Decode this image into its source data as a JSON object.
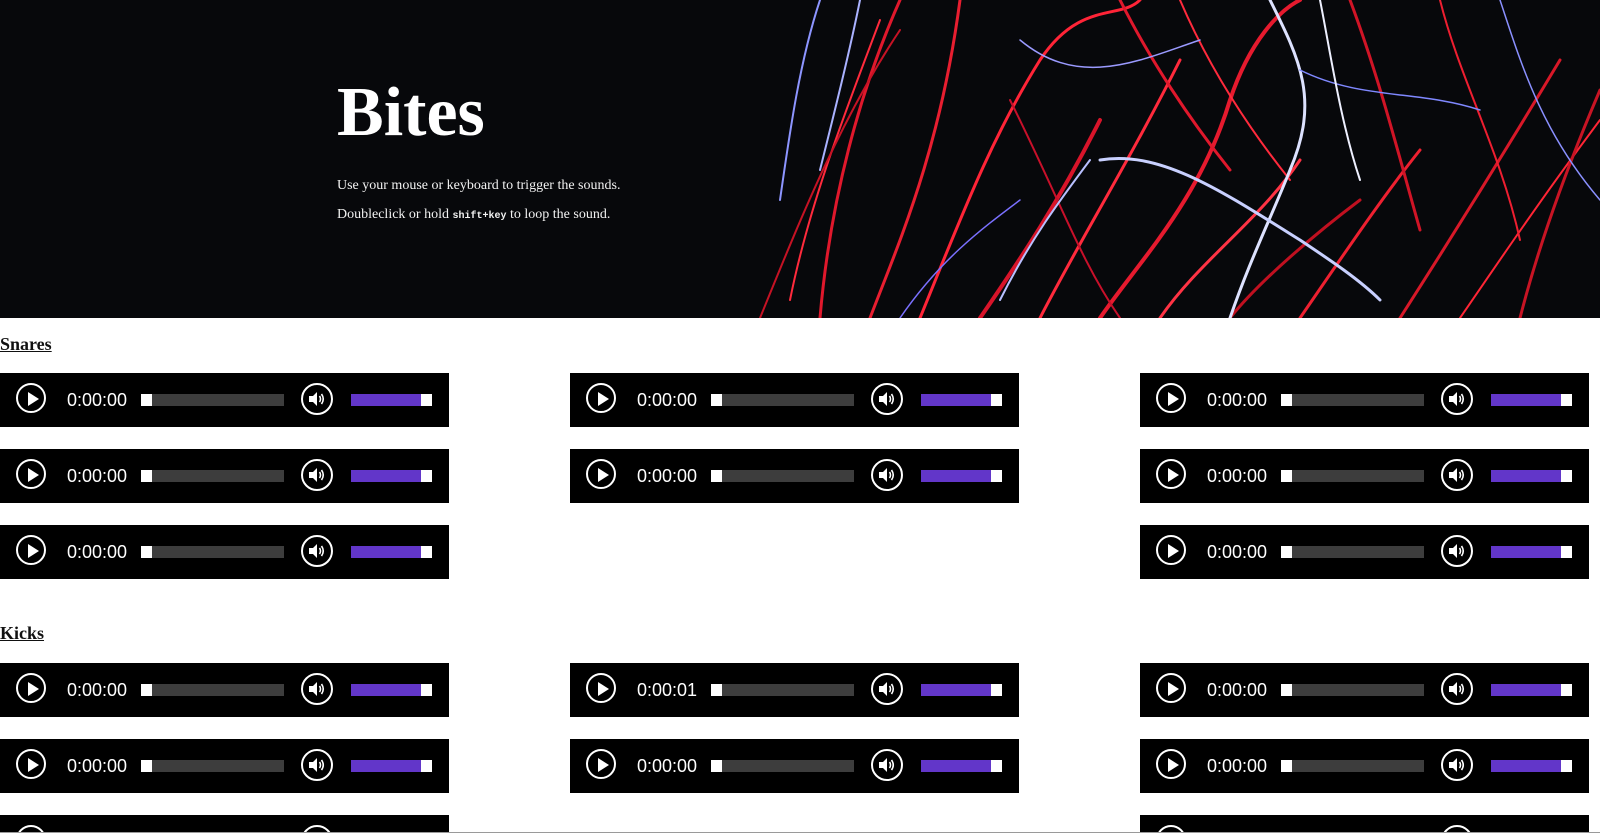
{
  "hero": {
    "title": "Bites",
    "line1": "Use your mouse or keyboard to trigger the sounds.",
    "line2_before": "Doubleclick or hold",
    "line2_key": "shift+key",
    "line2_after": "to loop the sound."
  },
  "sections": [
    {
      "title": "Snares",
      "players": [
        {
          "time": "0:00:00",
          "seek": 0,
          "volume": 1
        },
        {
          "time": "0:00:00",
          "seek": 0,
          "volume": 1
        },
        {
          "time": "0:00:00",
          "seek": 0,
          "volume": 1
        },
        {
          "time": "0:00:00",
          "seek": 0,
          "volume": 1
        },
        {
          "time": "0:00:00",
          "seek": 0,
          "volume": 1
        },
        {
          "time": "0:00:00",
          "seek": 0,
          "volume": 1
        },
        {
          "time": "0:00:00",
          "seek": 0,
          "volume": 1
        },
        {
          "time": "0:00:00",
          "seek": 0,
          "volume": 1
        }
      ]
    },
    {
      "title": "Kicks",
      "players": [
        {
          "time": "0:00:00",
          "seek": 0,
          "volume": 1
        },
        {
          "time": "0:00:01",
          "seek": 0,
          "volume": 1
        },
        {
          "time": "0:00:00",
          "seek": 0,
          "volume": 1
        },
        {
          "time": "0:00:00",
          "seek": 0,
          "volume": 1
        },
        {
          "time": "0:00:00",
          "seek": 0,
          "volume": 1
        },
        {
          "time": "0:00:00",
          "seek": 0,
          "volume": 1
        }
      ]
    }
  ],
  "icons": {
    "play": "play-icon",
    "volume": "speaker-volume-icon"
  },
  "colors": {
    "player_bg": "#000000",
    "volume_fill": "#6236c9",
    "track": "#3d3d3d",
    "hero_bg": "#07080b"
  }
}
